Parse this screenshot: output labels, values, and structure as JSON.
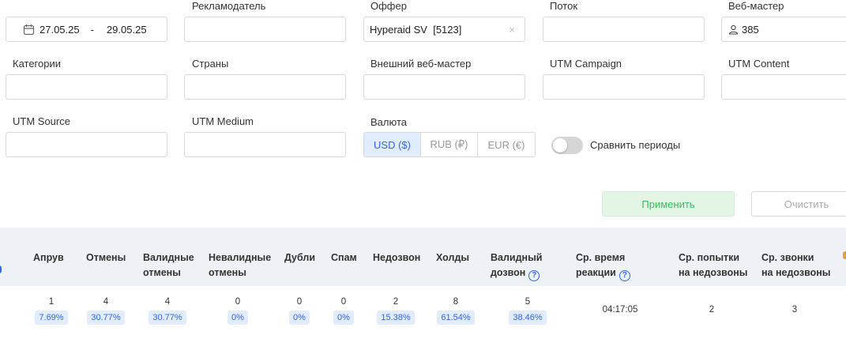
{
  "filters": {
    "date_from": "27.05.25",
    "date_sep": "-",
    "date_to": "29.05.25",
    "advertiser_label": "Рекламодатель",
    "offer_label": "Оффер",
    "offer_value": "Hyperaid SV  [5123]",
    "offer_clear": "×",
    "stream_label": "Поток",
    "webmaster_label": "Веб-мастер",
    "webmaster_value": "385",
    "categories_label": "Категории",
    "countries_label": "Страны",
    "ext_webmaster_label": "Внешний веб-мастер",
    "utm_campaign_label": "UTM Campaign",
    "utm_content_label": "UTM Content",
    "utm_source_label": "UTM Source",
    "utm_medium_label": "UTM Medium",
    "currency_label": "Валюта",
    "currencies": [
      "USD ($)",
      "RUB (₽)",
      "EUR (€)"
    ],
    "currency_selected": "USD ($)",
    "compare_label": "Сравнить периоды",
    "compare_enabled": false
  },
  "actions": {
    "apply": "Применить",
    "clear": "Очистить"
  },
  "table": {
    "headers": {
      "approve": "Апрув",
      "cancel": "Отмены",
      "valid_cancel_1": "Валидные",
      "valid_cancel_2": "отмены",
      "invalid_cancel_1": "Невалидные",
      "invalid_cancel_2": "отмены",
      "duplicates": "Дубли",
      "spam": "Спам",
      "no_answer": "Недозвон",
      "holds": "Холды",
      "valid_call_1": "Валидный",
      "valid_call_2": "дозвон",
      "avg_time_1": "Ср. время",
      "avg_time_2": "реакции",
      "avg_attempts_1": "Ср. попытки",
      "avg_attempts_2": "на недозвоны",
      "avg_calls_1": "Ср. звонки",
      "avg_calls_2": "на недозвоны",
      "help": "?"
    },
    "row": {
      "approve": {
        "count": "1",
        "pct": "7.69%"
      },
      "cancel": {
        "count": "4",
        "pct": "30.77%"
      },
      "valid_cancel": {
        "count": "4",
        "pct": "30.77%"
      },
      "invalid_cancel": {
        "count": "0",
        "pct": "0%"
      },
      "duplicates": {
        "count": "0",
        "pct": "0%"
      },
      "spam": {
        "count": "0",
        "pct": "0%"
      },
      "no_answer": {
        "count": "2",
        "pct": "15.38%"
      },
      "holds": {
        "count": "8",
        "pct": "61.54%"
      },
      "valid_call": {
        "count": "5",
        "pct": "38.46%"
      },
      "avg_time": "04:17:05",
      "avg_attempts": "2",
      "avg_calls": "3"
    }
  },
  "colors": {
    "accent": "#3366e8",
    "apply_text": "#3cbb5b",
    "header_bg": "#eef2f7"
  }
}
